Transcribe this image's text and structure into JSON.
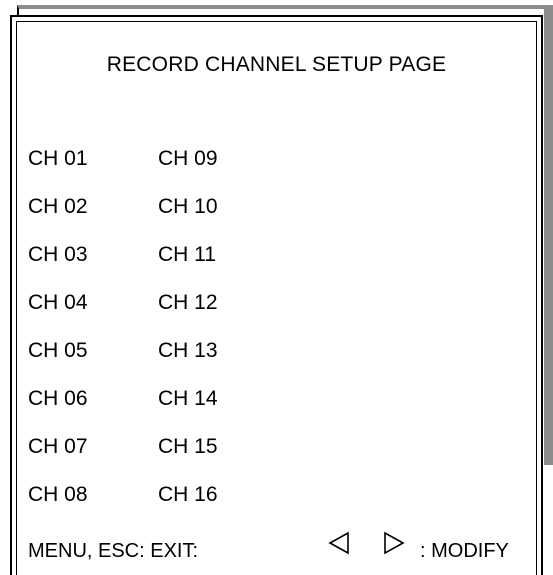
{
  "title": "RECORD CHANNEL SETUP PAGE",
  "channels_left": [
    "CH 01",
    "CH 02",
    "CH 03",
    "CH 04",
    "CH 05",
    "CH 06",
    "CH 07",
    "CH 08"
  ],
  "channels_right": [
    "CH 09",
    "CH 10",
    "CH 11",
    "CH 12",
    "CH 13",
    "CH 14",
    "CH 15",
    "CH 16"
  ],
  "footer": {
    "exit_label": "MENU, ESC: EXIT:",
    "left_arrow_icon": "triangle-left-icon",
    "right_arrow_icon": "triangle-right-icon",
    "modify_label": ": MODIFY"
  }
}
